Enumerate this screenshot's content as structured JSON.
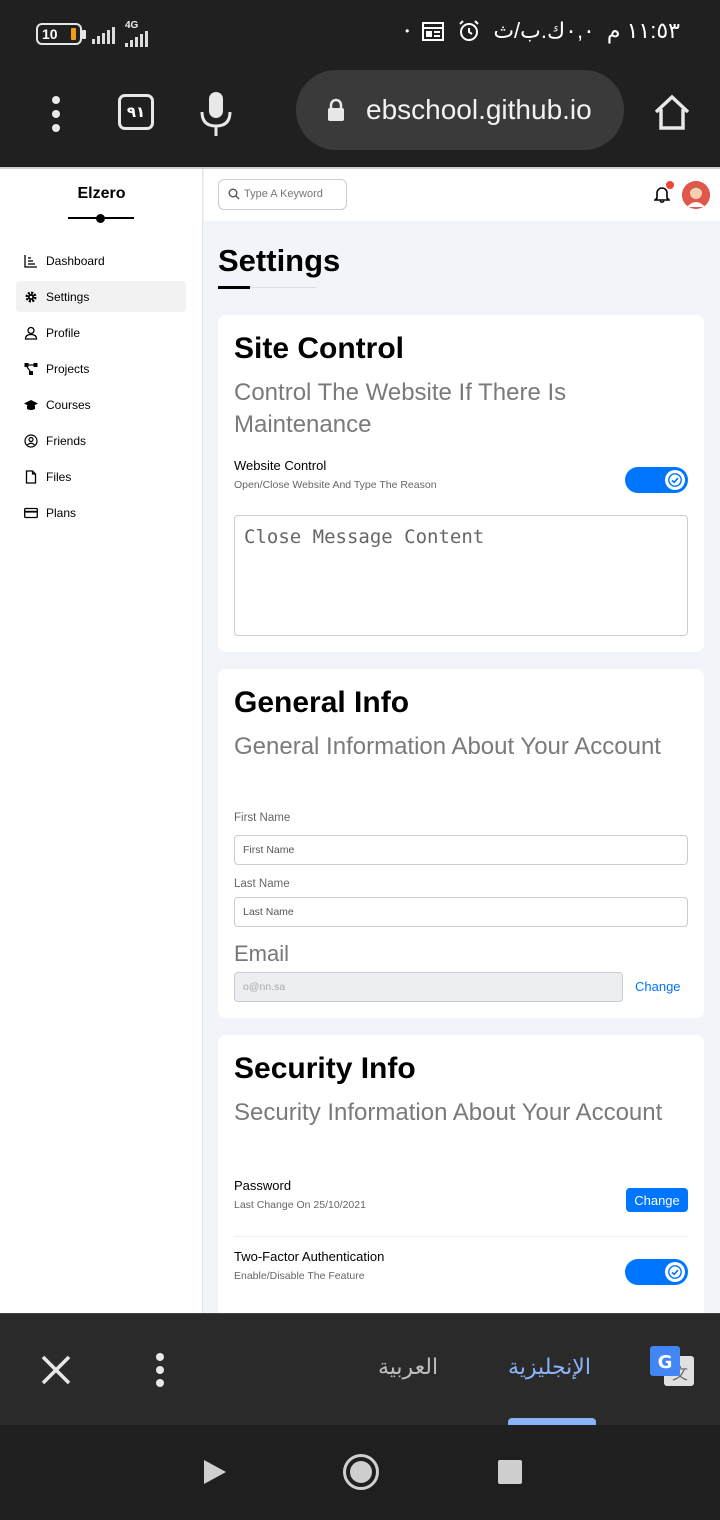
{
  "status_bar": {
    "battery": "10",
    "network": "4G",
    "date": "٠,٠ك.ب/ث",
    "time": "١١:٥٣ م"
  },
  "browser": {
    "tab_count": "٩١",
    "url": "ebschool.github.io"
  },
  "sidebar": {
    "brand": "Elzero",
    "items": [
      {
        "label": "Dashboard",
        "icon": "chart-icon"
      },
      {
        "label": "Settings",
        "icon": "gear-icon",
        "active": true
      },
      {
        "label": "Profile",
        "icon": "user-icon"
      },
      {
        "label": "Projects",
        "icon": "diagram-icon"
      },
      {
        "label": "Courses",
        "icon": "graduation-cap-icon"
      },
      {
        "label": "Friends",
        "icon": "user-circle-icon"
      },
      {
        "label": "Files",
        "icon": "file-icon"
      },
      {
        "label": "Plans",
        "icon": "credit-card-icon"
      }
    ]
  },
  "topbar": {
    "search_placeholder": "Type A Keyword"
  },
  "page": {
    "title": "Settings"
  },
  "site_control": {
    "title": "Site Control",
    "subtitle": "Control The Website If There Is Maintenance",
    "row_title": "Website Control",
    "row_desc": "Open/Close Website And Type The Reason",
    "toggle_on": true,
    "textarea_placeholder": "Close Message Content"
  },
  "general_info": {
    "title": "General Info",
    "subtitle": "General Information About Your Account",
    "first_name_label": "First Name",
    "first_name_placeholder": "First Name",
    "last_name_label": "Last Name",
    "last_name_placeholder": "Last Name",
    "email_label": "Email",
    "email_value": "o@nn.sa",
    "change_label": "Change"
  },
  "security_info": {
    "title": "Security Info",
    "subtitle": "Security Information About Your Account",
    "password_title": "Password",
    "password_desc": "Last Change On 25/10/2021",
    "change_label": "Change",
    "two_factor_title": "Two-Factor Authentication",
    "two_factor_desc": "Enable/Disable The Feature",
    "two_factor_on": true
  },
  "translate_bar": {
    "lang_source": "العربية",
    "lang_target": "الإنجليزية"
  },
  "colors": {
    "accent": "#0075ff",
    "background": "#f1f5f9",
    "notification": "#f44336"
  }
}
